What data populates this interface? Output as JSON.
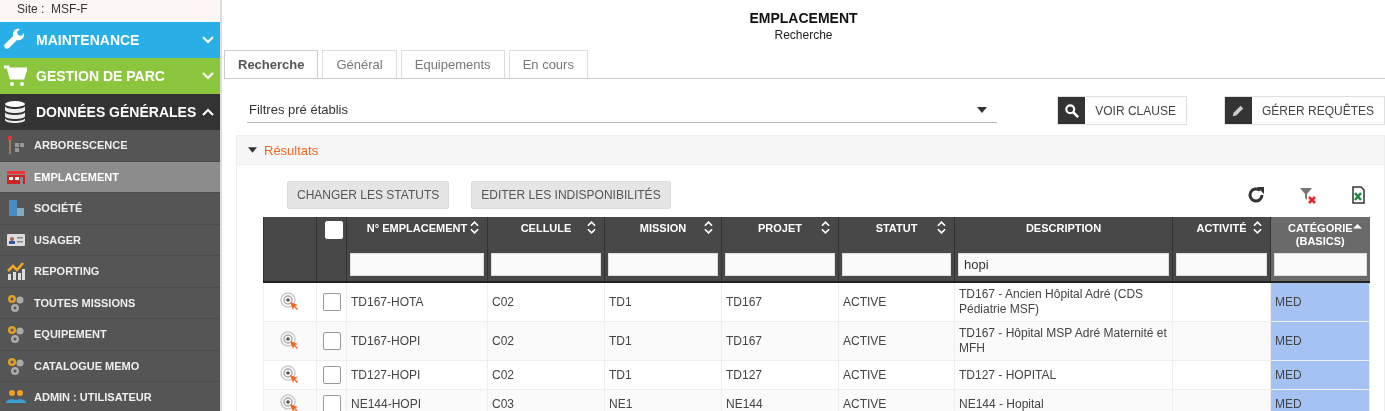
{
  "sidebar": {
    "site_label": "Site :",
    "site": "MSF-F",
    "sections": [
      {
        "label": "MAINTENANCE",
        "color": "#29aee6",
        "expanded": false
      },
      {
        "label": "GESTION DE PARC",
        "color": "#8cc63f",
        "expanded": false
      },
      {
        "label": "DONNÉES GÉNÉRALES",
        "color": "#333333",
        "expanded": true,
        "items": [
          {
            "label": "ARBORESCENCE",
            "selected": false
          },
          {
            "label": "EMPLACEMENT",
            "selected": true
          },
          {
            "label": "SOCIÉTÉ",
            "selected": false
          },
          {
            "label": "USAGER",
            "selected": false
          },
          {
            "label": "REPORTING",
            "selected": false
          },
          {
            "label": "TOUTES MISSIONS",
            "selected": false
          },
          {
            "label": "EQUIPEMENT",
            "selected": false
          },
          {
            "label": "CATALOGUE MEMO",
            "selected": false
          },
          {
            "label": "ADMIN : UTILISATEUR",
            "selected": false
          }
        ]
      }
    ]
  },
  "header": {
    "title": "EMPLACEMENT",
    "subtitle": "Recherche"
  },
  "tabs": [
    {
      "label": "Recherche",
      "selected": true
    },
    {
      "label": "Général",
      "selected": false
    },
    {
      "label": "Equipements",
      "selected": false
    },
    {
      "label": "En cours",
      "selected": false
    }
  ],
  "filter": {
    "label": "Filtres pré établis"
  },
  "query_buttons": [
    {
      "label": "VOIR CLAUSE"
    },
    {
      "label": "GÉRER REQUÊTES"
    }
  ],
  "results": {
    "title": "Résultats",
    "expanded": true,
    "actions": [
      "CHANGER LES STATUTS",
      "EDITER LES INDISPONIBILITÉS"
    ],
    "table": {
      "header_checked": false,
      "columns": [
        {
          "label": "N° EMPLACEMENT",
          "sortable": true,
          "sorted": false
        },
        {
          "label": "CELLULE",
          "sortable": true,
          "sorted": false
        },
        {
          "label": "MISSION",
          "sortable": true,
          "sorted": false
        },
        {
          "label": "PROJET",
          "sortable": true,
          "sorted": false
        },
        {
          "label": "STATUT",
          "sortable": true,
          "sorted": false
        },
        {
          "label": "DESCRIPTION",
          "sortable": false,
          "sorted": false,
          "filter": "hopi"
        },
        {
          "label": "ACTIVITÉ",
          "sortable": true,
          "sorted": false
        },
        {
          "label": "CATÉGORIE (BASICS)",
          "sortable": true,
          "sorted": true
        }
      ],
      "rows": [
        {
          "checked": false,
          "cells": [
            "TD167-HOTA",
            "C02",
            "TD1",
            "TD167",
            "ACTIVE",
            "TD167 - Ancien Hôpital Adré (CDS Pédiatrie MSF)",
            null,
            "MED"
          ]
        },
        {
          "checked": false,
          "cells": [
            "TD167-HOPI",
            "C02",
            "TD1",
            "TD167",
            "ACTIVE",
            "TD167 - Hôpital MSP Adré Maternité et MFH",
            null,
            "MED"
          ]
        },
        {
          "checked": false,
          "cells": [
            "TD127-HOPI",
            "C02",
            "TD1",
            "TD127",
            "ACTIVE",
            "TD127 - HOPITAL",
            null,
            "MED"
          ]
        },
        {
          "checked": false,
          "cells": [
            "NE144-HOPI",
            "C03",
            "NE1",
            "NE144",
            "ACTIVE",
            "NE144 - Hopital",
            null,
            "MED"
          ]
        }
      ]
    }
  }
}
